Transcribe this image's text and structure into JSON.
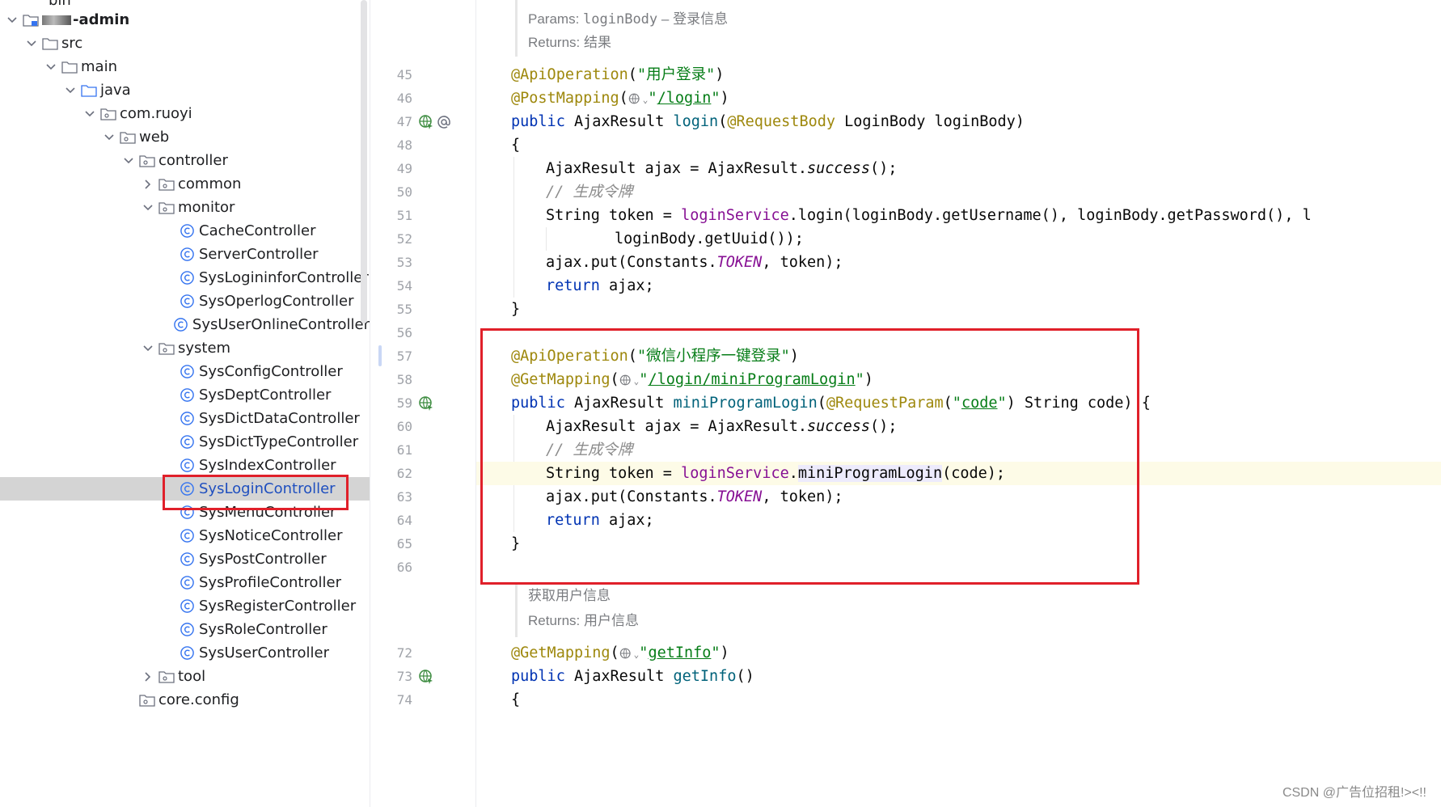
{
  "tree": {
    "top_label": "bin",
    "project": "-admin",
    "src": "src",
    "main": "main",
    "java": "java",
    "package": "com.ruoyi",
    "web": "web",
    "controller": "controller",
    "common": "common",
    "monitor": "monitor",
    "monitor_items": [
      "CacheController",
      "ServerController",
      "SysLogininforController",
      "SysOperlogController",
      "SysUserOnlineController"
    ],
    "system": "system",
    "system_items": [
      "SysConfigController",
      "SysDeptController",
      "SysDictDataController",
      "SysDictTypeController",
      "SysIndexController",
      "SysLoginController",
      "SysMenuController",
      "SysNoticeController",
      "SysPostController",
      "SysProfileController",
      "SysRegisterController",
      "SysRoleController",
      "SysUserController"
    ],
    "selected": "SysLoginController",
    "tool": "tool",
    "core_config": "core.config"
  },
  "gutter": {
    "line_numbers": [
      "45",
      "46",
      "47",
      "48",
      "49",
      "50",
      "51",
      "52",
      "53",
      "54",
      "55",
      "56",
      "57",
      "58",
      "59",
      "60",
      "61",
      "62",
      "63",
      "64",
      "65",
      "66",
      "72",
      "73",
      "74"
    ]
  },
  "editor": {
    "doc1_params_label": "Params:",
    "doc1_params_name": "loginBody",
    "doc1_params_desc": "– 登录信息",
    "doc1_returns_label": "Returns:",
    "doc1_returns_desc": "结果",
    "l45_ann": "@ApiOperation",
    "l45_str": "\"用户登录\"",
    "l46_ann": "@PostMapping",
    "l46_str": "\"/login\"",
    "l47_kw": "public",
    "l47_type": "AjaxResult",
    "l47_fn": "login",
    "l47_ann": "@RequestBody",
    "l47_rest": "LoginBody loginBody)",
    "brace_open": "{",
    "brace_close": "}",
    "l49_a": "AjaxResult ajax = AjaxResult.",
    "l49_m": "success",
    "l49_b": "();",
    "comment_token": "// 生成令牌",
    "l51_a": "String token = ",
    "l51_svc": "loginService",
    "l51_b": ".login(loginBody.getUsername(), loginBody.getPassword(), l",
    "l52": "loginBody.getUuid());",
    "put_a": "ajax.put(Constants.",
    "put_const": "TOKEN",
    "put_b": ", token);",
    "ret_kw": "return",
    "ret_rest": " ajax;",
    "l57_ann": "@ApiOperation",
    "l57_str": "\"微信小程序一键登录\"",
    "l58_ann": "@GetMapping",
    "l58_str": "\"/login/miniProgramLogin\"",
    "l59_kw": "public",
    "l59_type": "AjaxResult",
    "l59_fn": "miniProgramLogin",
    "l59_ann": "@RequestParam",
    "l59_str": "\"code\"",
    "l59_rest": " String code) {",
    "l62_a": "String token = ",
    "l62_svc": "loginService",
    "l62_dot": ".",
    "l62_m": "miniProgramLogin",
    "l62_b": "(code);",
    "doc2_desc": "获取用户信息",
    "doc2_returns_label": "Returns:",
    "doc2_returns_desc": "用户信息",
    "l72_ann": "@GetMapping",
    "l72_str": "\"getInfo\"",
    "l73_kw": "public",
    "l73_type": "AjaxResult",
    "l73_fn": "getInfo",
    "l73_rest": "()",
    "paren_open": "(",
    "paren_close": ")"
  },
  "watermark": "CSDN @广告位招租!><!!",
  "colors": {
    "annotation": "#9e880d",
    "string": "#067d17",
    "keyword": "#0033b3",
    "function": "#00627a",
    "field": "#871094",
    "highlight_box": "#e0202a",
    "selection": "#d4d4d4"
  }
}
